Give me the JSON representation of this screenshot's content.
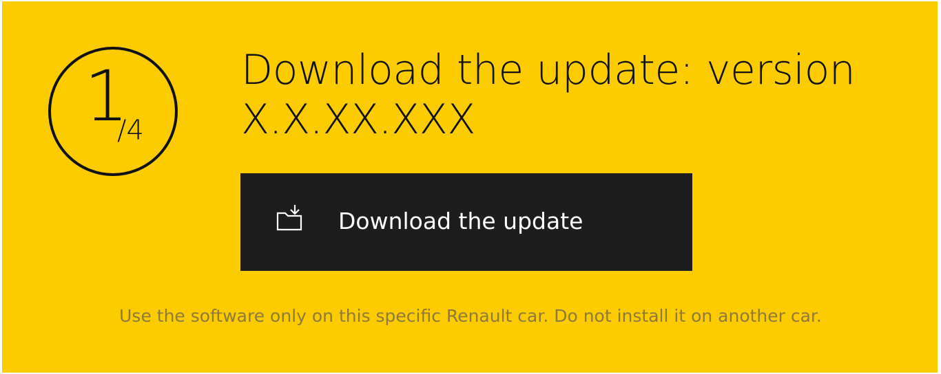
{
  "step": {
    "current": "1",
    "total": "/4"
  },
  "title": "Download the update: version X.X.XX.XXX",
  "download_button": {
    "label": "Download the update",
    "icon": "download-folder-icon"
  },
  "disclaimer": "Use the software only on this specific Renault car. Do not install it on another car.",
  "colors": {
    "background": "#fccc00",
    "button": "#1d1d1d",
    "button_text": "#ffffff",
    "text": "#111111",
    "disclaimer": "#8f7a3a"
  }
}
